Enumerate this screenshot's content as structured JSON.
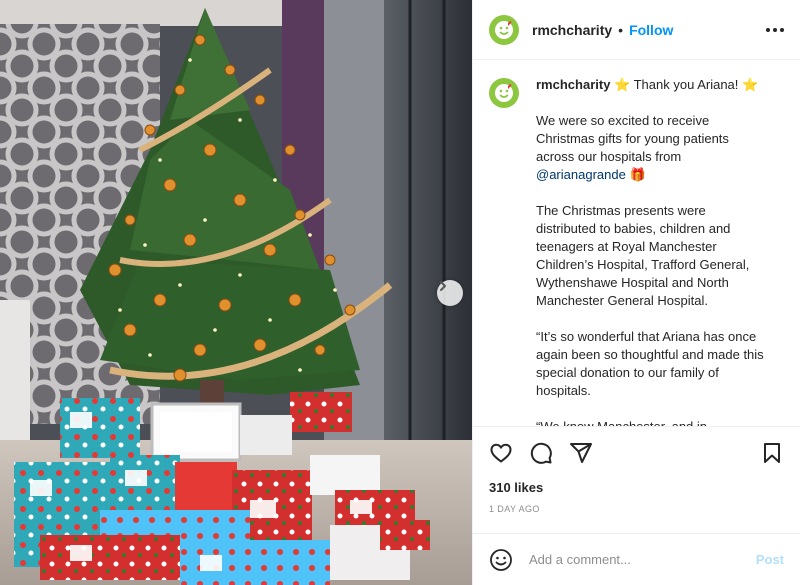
{
  "header": {
    "username": "rmchcharity",
    "separator": "•",
    "follow_label": "Follow",
    "avatar_icon": "smiley-heart-logo",
    "more_icon": "more-options-icon"
  },
  "caption": {
    "username": "rmchcharity",
    "first_line": "⭐ Thank you Ariana! ⭐",
    "para1_text": "We were so excited to receive Christmas gifts for young patients across our hospitals from",
    "para1_mention": "@arianagrande",
    "para1_emoji": "🎁",
    "para2": "The Christmas presents were distributed to babies, children and teenagers at Royal Manchester Children’s Hospital, Trafford General, Wythenshawe Hospital and North Manchester General Hospital.",
    "para3": "“It’s so wonderful that Ariana has once again been so thoughtful and made this special donation to our family of hospitals.",
    "para4": "“We know Manchester, and in"
  },
  "actions": {
    "like_icon": "heart-icon",
    "comment_icon": "comment-icon",
    "share_icon": "share-icon",
    "save_icon": "bookmark-icon"
  },
  "likes": "310 likes",
  "timestamp": "1 DAY AGO",
  "comment": {
    "placeholder": "Add a comment...",
    "post_label": "Post",
    "emoji_icon": "emoji-icon"
  },
  "colors": {
    "accent": "#0095f6",
    "brand": "#8dc63f",
    "post_disabled": "#b2dffc"
  }
}
